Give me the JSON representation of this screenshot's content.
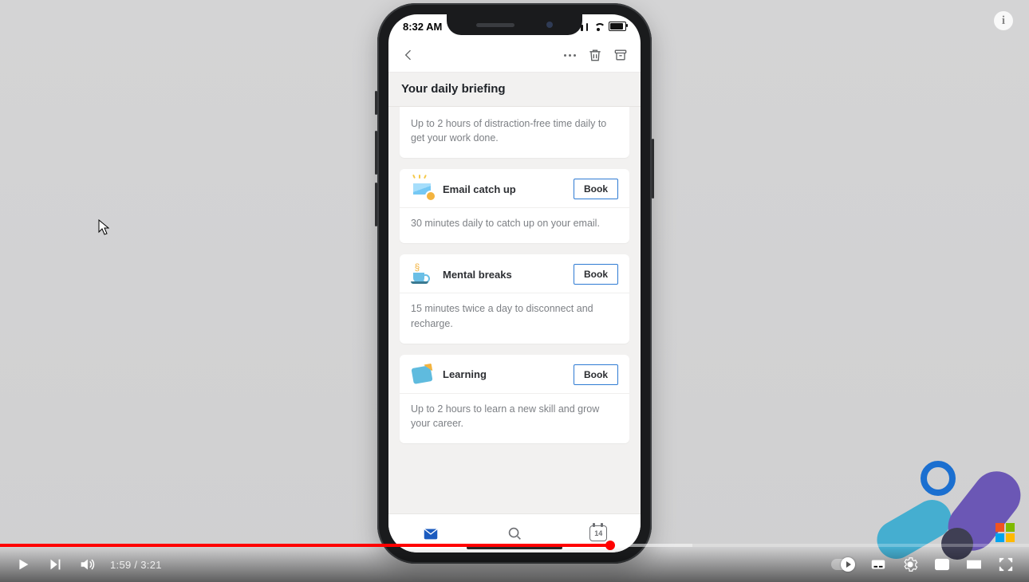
{
  "phone": {
    "status_time": "8:32 AM",
    "header_title": "Your daily briefing",
    "cards": [
      {
        "title": "",
        "desc": "Up to 2 hours of distraction-free time daily to get your work done.",
        "action": ""
      },
      {
        "title": "Email catch up",
        "desc": "30 minutes daily to catch up on your email.",
        "action": "Book"
      },
      {
        "title": "Mental breaks",
        "desc": "15 minutes twice a day to disconnect and recharge.",
        "action": "Book"
      },
      {
        "title": "Learning",
        "desc": "Up to 2 hours to learn a new skill and grow your career.",
        "action": "Book"
      }
    ],
    "nav_calendar_day": "14"
  },
  "player": {
    "current": "1:59",
    "sep": " / ",
    "duration": "3:21"
  }
}
